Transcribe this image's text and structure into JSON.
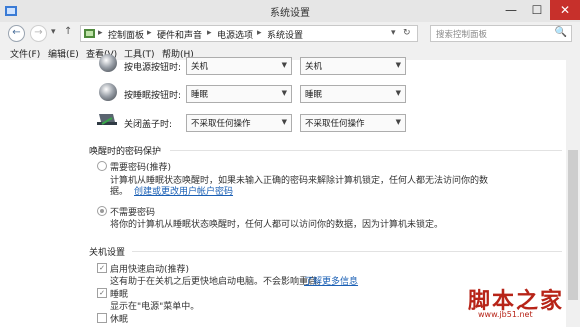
{
  "window": {
    "title": "系统设置",
    "min": "—",
    "max": "☐",
    "close": "✕"
  },
  "nav": {
    "back": "←",
    "forward": "→",
    "history": "▾",
    "up": "↑",
    "breadcrumbs": [
      "控制面板",
      "硬件和声音",
      "电源选项",
      "系统设置"
    ],
    "separator": "▸",
    "refresh": "↻",
    "search_placeholder": "搜索控制面板",
    "search_icon": "🔍"
  },
  "menu": [
    "文件(F)",
    "编辑(E)",
    "查看(V)",
    "工具(T)",
    "帮助(H)"
  ],
  "power_rows": [
    {
      "label": "按电源按钮时:",
      "battery": "关机",
      "plugged": "关机"
    },
    {
      "label": "按睡眠按钮时:",
      "battery": "睡眠",
      "plugged": "睡眠"
    },
    {
      "label": "关闭盖子时:",
      "battery": "不采取任何操作",
      "plugged": "不采取任何操作"
    }
  ],
  "password": {
    "section_title": "唤醒时的密码保护",
    "require": {
      "label": "需要密码(推荐)",
      "desc1": "计算机从睡眠状态唤醒时，如果未输入正确的密码来解除计算机锁定，任何人都无法访问你的数",
      "desc2": "据。",
      "link": "创建或更改用户帐户密码"
    },
    "norequire": {
      "label": "不需要密码",
      "desc": "将你的计算机从睡眠状态唤醒时，任何人都可以访问你的数据，因为计算机未锁定。"
    }
  },
  "shutdown": {
    "section_title": "关机设置",
    "fast": {
      "label": "启用快速启动(推荐)",
      "desc": "这有助于在关机之后更快地启动电脑。不会影响重启。",
      "link": "了解更多信息"
    },
    "sleep": {
      "label": "睡眠",
      "desc": "显示在\"电源\"菜单中。"
    },
    "hibernate": {
      "label": "休眠"
    }
  },
  "watermark": {
    "brand": "脚本之家",
    "url": "www.jb51.net"
  }
}
